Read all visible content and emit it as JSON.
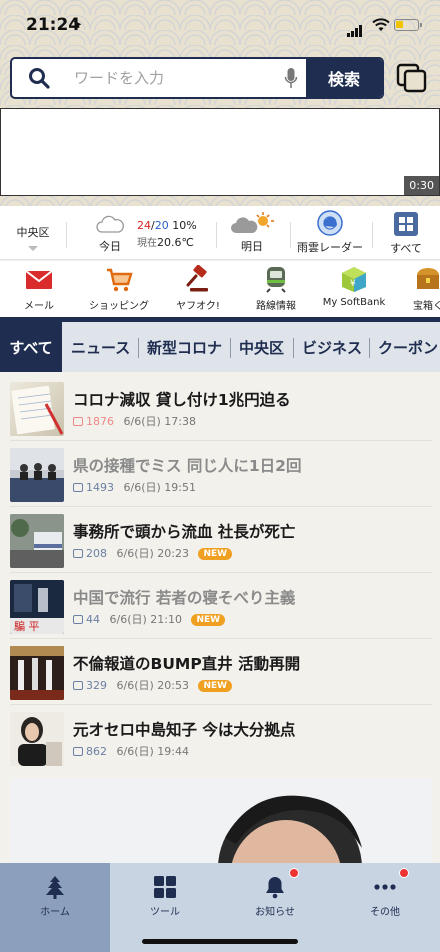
{
  "status": {
    "time": "21:24",
    "battery_level": 0.35
  },
  "search": {
    "placeholder": "ワードを入力",
    "button_label": "検索"
  },
  "ad": {
    "timer": "0:30"
  },
  "weather": {
    "region": "中央区",
    "today": {
      "label": "今日",
      "hi": "24",
      "lo": "20",
      "precip": "10%",
      "now_label": "現在",
      "now_temp": "20.6℃"
    },
    "tomorrow": {
      "label": "明日"
    },
    "radar": {
      "label": "雨雲レーダー"
    },
    "all": {
      "label": "すべて"
    }
  },
  "services": [
    {
      "label": "メール",
      "icon": "mail-icon"
    },
    {
      "label": "ショッピング",
      "icon": "cart-icon"
    },
    {
      "label": "ヤフオク!",
      "icon": "gavel-icon"
    },
    {
      "label": "路線情報",
      "icon": "train-icon"
    },
    {
      "label": "My SoftBank",
      "icon": "softbank-icon"
    },
    {
      "label": "宝箱く",
      "icon": "treasure-icon"
    }
  ],
  "categories": [
    "すべて",
    "ニュース",
    "新型コロナ",
    "中央区",
    "ビジネス",
    "クーポン"
  ],
  "news": [
    {
      "title": "コロナ減収 貸し付け1兆円迫る",
      "comments": "1876",
      "date": "6/6(日) 17:38",
      "is_new": false,
      "read": false,
      "hot": true
    },
    {
      "title": "県の接種でミス 同じ人に1日2回",
      "comments": "1493",
      "date": "6/6(日) 19:51",
      "is_new": false,
      "read": true,
      "hot": false
    },
    {
      "title": "事務所で頭から流血 社長が死亡",
      "comments": "208",
      "date": "6/6(日) 20:23",
      "is_new": true,
      "read": false,
      "hot": false
    },
    {
      "title": "中国で流行 若者の寝そべり主義",
      "comments": "44",
      "date": "6/6(日) 21:10",
      "is_new": true,
      "read": true,
      "hot": false
    },
    {
      "title": "不倫報道のBUMP直井 活動再開",
      "comments": "329",
      "date": "6/6(日) 20:53",
      "is_new": true,
      "read": false,
      "hot": false
    },
    {
      "title": "元オセロ中島知子 今は大分拠点",
      "comments": "862",
      "date": "6/6(日) 19:44",
      "is_new": false,
      "read": false,
      "hot": false
    }
  ],
  "new_badge": "NEW",
  "thumb_caption": "騙 平",
  "bottom_nav": [
    {
      "label": "ホーム",
      "icon": "tree-icon",
      "active": true,
      "badge": false
    },
    {
      "label": "ツール",
      "icon": "grid-icon",
      "active": false,
      "badge": false
    },
    {
      "label": "お知らせ",
      "icon": "bell-icon",
      "active": false,
      "badge": true
    },
    {
      "label": "その他",
      "icon": "more-icon",
      "active": false,
      "badge": true
    }
  ],
  "colors": {
    "navy": "#1f2d50",
    "hi_temp": "#d22222",
    "lo_temp": "#2a62c8",
    "new_badge": "#f0a020",
    "badge_dot": "#e33333"
  }
}
